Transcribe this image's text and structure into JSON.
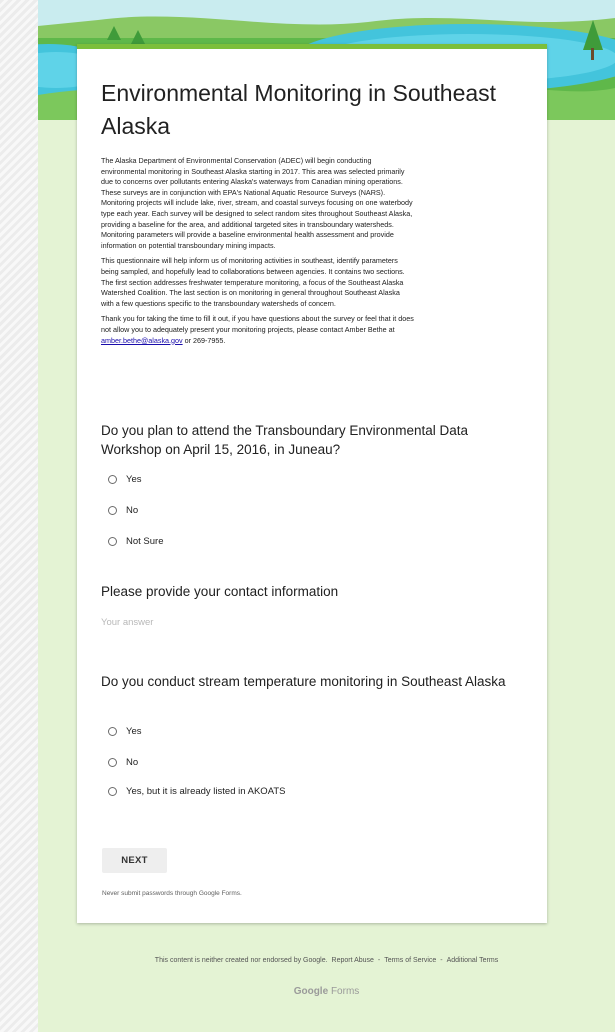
{
  "form": {
    "title": "Environmental Monitoring in Southeast Alaska",
    "description": {
      "p1": "The Alaska Department of Environmental Conservation (ADEC) will begin conducting\nenvironmental monitoring in Southeast Alaska starting in 2017. This area was selected primarily\ndue to concerns over pollutants entering Alaska's waterways from Canadian mining operations.\nThese surveys are in conjunction with EPA's National Aquatic Resource Surveys (NARS).\nMonitoring projects will include lake, river, stream, and coastal surveys focusing on one waterbody\ntype each year. Each survey will be designed to select random sites throughout Southeast Alaska,\nproviding a baseline for the area, and additional targeted sites in transboundary watersheds.\nMonitoring parameters will provide a baseline environmental health assessment and provide\ninformation on potential transboundary mining impacts.",
      "p2": "This questionnaire will help inform us of monitoring activities in southeast, identify parameters\nbeing sampled, and hopefully lead to collaborations between agencies.  It contains two sections.\nThe first section addresses freshwater temperature monitoring, a focus of the Southeast Alaska\nWatershed Coalition.  The last section is on monitoring in general throughout Southeast Alaska\nwith a few questions specific to the transboundary watersheds of concern.",
      "p3_before": "Thank you for taking the time to fill it out, if you have questions about the survey or feel that it does\nnot allow you to adequately present your monitoring projects, please contact Amber Bethe at\n",
      "p3_email": "amber.bethe@alaska.gov",
      "p3_after": " or 269-7955."
    },
    "q1": {
      "text": "Do you plan to attend the Transboundary Environmental Data Workshop on April 15, 2016, in Juneau?",
      "options": [
        "Yes",
        "No",
        "Not Sure"
      ]
    },
    "q2": {
      "text": "Please provide your contact information",
      "placeholder": "Your answer"
    },
    "q3": {
      "text": "Do you conduct stream temperature monitoring in Southeast Alaska",
      "options": [
        "Yes",
        "No",
        "Yes, but it is already listed in AKOATS"
      ]
    },
    "next_label": "NEXT",
    "password_warning": "Never submit passwords through Google Forms."
  },
  "footer": {
    "disclaimer": "This content is neither created nor endorsed by Google.",
    "report_abuse": "Report Abuse",
    "sep1": "-",
    "terms": "Terms of Service",
    "sep2": "-",
    "additional_terms": "Additional Terms",
    "brand_google": "Google",
    "brand_forms": "Forms"
  },
  "colors": {
    "accent": "#7cbf3b",
    "page_background": "#e4f3d4",
    "link": "#1a0dab"
  }
}
